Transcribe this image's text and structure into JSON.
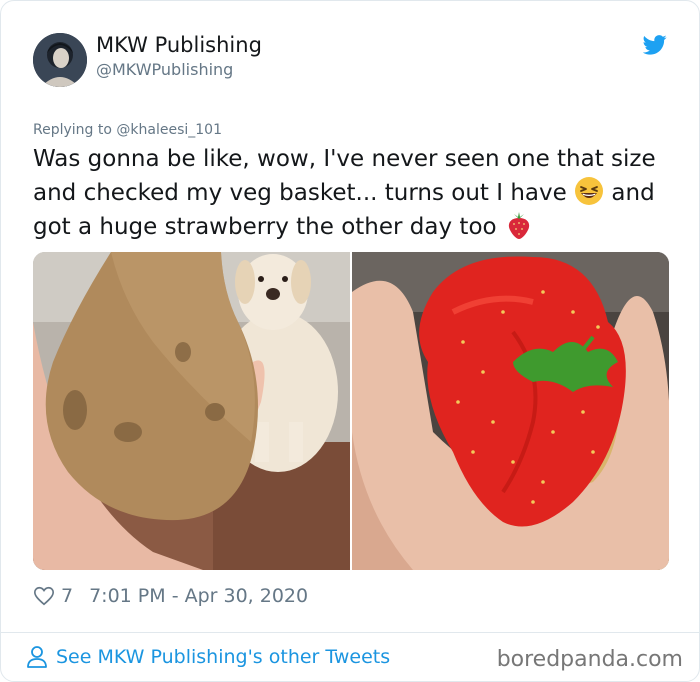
{
  "author": {
    "name": "MKW Publishing",
    "handle": "@MKWPublishing",
    "avatar_icon": "avatar-photo"
  },
  "reply": {
    "prefix": "Replying to ",
    "target": "@khaleesi_101"
  },
  "tweet": {
    "line1": "Was gonna be like, wow, I've never seen one that size and checked my veg basket... turns out I have ",
    "line2": " and got a huge strawberry the other day too ",
    "emoji1": "grinning-squinting-face",
    "emoji2": "strawberry"
  },
  "meta": {
    "likes": "7",
    "timestamp": "7:01 PM - Apr 30, 2020"
  },
  "footer": {
    "link": "See MKW Publishing's other Tweets",
    "watermark": "boredpanda.com"
  },
  "colors": {
    "link": "#1b95e0",
    "muted": "#657786",
    "twitter_blue": "#1da1f2"
  }
}
